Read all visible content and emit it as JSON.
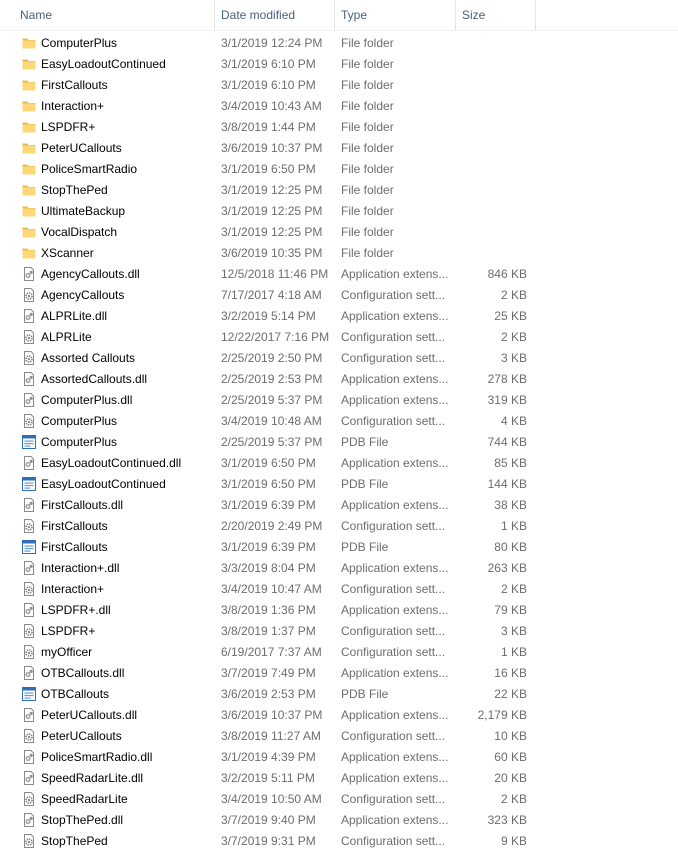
{
  "columns": {
    "name": "Name",
    "date": "Date modified",
    "type": "Type",
    "size": "Size"
  },
  "files": [
    {
      "name": "ComputerPlus",
      "date": "3/1/2019 12:24 PM",
      "type": "File folder",
      "size": "",
      "icon": "folder-icon"
    },
    {
      "name": "EasyLoadoutContinued",
      "date": "3/1/2019 6:10 PM",
      "type": "File folder",
      "size": "",
      "icon": "folder-icon"
    },
    {
      "name": "FirstCallouts",
      "date": "3/1/2019 6:10 PM",
      "type": "File folder",
      "size": "",
      "icon": "folder-icon"
    },
    {
      "name": "Interaction+",
      "date": "3/4/2019 10:43 AM",
      "type": "File folder",
      "size": "",
      "icon": "folder-icon"
    },
    {
      "name": "LSPDFR+",
      "date": "3/8/2019 1:44 PM",
      "type": "File folder",
      "size": "",
      "icon": "folder-icon"
    },
    {
      "name": "PeterUCallouts",
      "date": "3/6/2019 10:37 PM",
      "type": "File folder",
      "size": "",
      "icon": "folder-icon"
    },
    {
      "name": "PoliceSmartRadio",
      "date": "3/1/2019 6:50 PM",
      "type": "File folder",
      "size": "",
      "icon": "folder-icon"
    },
    {
      "name": "StopThePed",
      "date": "3/1/2019 12:25 PM",
      "type": "File folder",
      "size": "",
      "icon": "folder-icon"
    },
    {
      "name": "UltimateBackup",
      "date": "3/1/2019 12:25 PM",
      "type": "File folder",
      "size": "",
      "icon": "folder-icon"
    },
    {
      "name": "VocalDispatch",
      "date": "3/1/2019 12:25 PM",
      "type": "File folder",
      "size": "",
      "icon": "folder-icon"
    },
    {
      "name": "XScanner",
      "date": "3/6/2019 10:35 PM",
      "type": "File folder",
      "size": "",
      "icon": "folder-icon"
    },
    {
      "name": "AgencyCallouts.dll",
      "date": "12/5/2018 11:46 PM",
      "type": "Application extens...",
      "size": "846 KB",
      "icon": "dll-icon"
    },
    {
      "name": "AgencyCallouts",
      "date": "7/17/2017 4:18 AM",
      "type": "Configuration sett...",
      "size": "2 KB",
      "icon": "config-icon"
    },
    {
      "name": "ALPRLite.dll",
      "date": "3/2/2019 5:14 PM",
      "type": "Application extens...",
      "size": "25 KB",
      "icon": "dll-icon"
    },
    {
      "name": "ALPRLite",
      "date": "12/22/2017 7:16 PM",
      "type": "Configuration sett...",
      "size": "2 KB",
      "icon": "config-icon"
    },
    {
      "name": "Assorted Callouts",
      "date": "2/25/2019 2:50 PM",
      "type": "Configuration sett...",
      "size": "3 KB",
      "icon": "config-icon"
    },
    {
      "name": "AssortedCallouts.dll",
      "date": "2/25/2019 2:53 PM",
      "type": "Application extens...",
      "size": "278 KB",
      "icon": "dll-icon"
    },
    {
      "name": "ComputerPlus.dll",
      "date": "2/25/2019 5:37 PM",
      "type": "Application extens...",
      "size": "319 KB",
      "icon": "dll-icon"
    },
    {
      "name": "ComputerPlus",
      "date": "3/4/2019 10:48 AM",
      "type": "Configuration sett...",
      "size": "4 KB",
      "icon": "config-icon"
    },
    {
      "name": "ComputerPlus",
      "date": "2/25/2019 5:37 PM",
      "type": "PDB File",
      "size": "744 KB",
      "icon": "pdb-icon"
    },
    {
      "name": "EasyLoadoutContinued.dll",
      "date": "3/1/2019 6:50 PM",
      "type": "Application extens...",
      "size": "85 KB",
      "icon": "dll-icon"
    },
    {
      "name": "EasyLoadoutContinued",
      "date": "3/1/2019 6:50 PM",
      "type": "PDB File",
      "size": "144 KB",
      "icon": "pdb-icon"
    },
    {
      "name": "FirstCallouts.dll",
      "date": "3/1/2019 6:39 PM",
      "type": "Application extens...",
      "size": "38 KB",
      "icon": "dll-icon"
    },
    {
      "name": "FirstCallouts",
      "date": "2/20/2019 2:49 PM",
      "type": "Configuration sett...",
      "size": "1 KB",
      "icon": "config-icon"
    },
    {
      "name": "FirstCallouts",
      "date": "3/1/2019 6:39 PM",
      "type": "PDB File",
      "size": "80 KB",
      "icon": "pdb-icon"
    },
    {
      "name": "Interaction+.dll",
      "date": "3/3/2019 8:04 PM",
      "type": "Application extens...",
      "size": "263 KB",
      "icon": "dll-icon"
    },
    {
      "name": "Interaction+",
      "date": "3/4/2019 10:47 AM",
      "type": "Configuration sett...",
      "size": "2 KB",
      "icon": "config-icon"
    },
    {
      "name": "LSPDFR+.dll",
      "date": "3/8/2019 1:36 PM",
      "type": "Application extens...",
      "size": "79 KB",
      "icon": "dll-icon"
    },
    {
      "name": "LSPDFR+",
      "date": "3/8/2019 1:37 PM",
      "type": "Configuration sett...",
      "size": "3 KB",
      "icon": "config-icon"
    },
    {
      "name": "myOfficer",
      "date": "6/19/2017 7:37 AM",
      "type": "Configuration sett...",
      "size": "1 KB",
      "icon": "config-icon"
    },
    {
      "name": "OTBCallouts.dll",
      "date": "3/7/2019 7:49 PM",
      "type": "Application extens...",
      "size": "16 KB",
      "icon": "dll-icon"
    },
    {
      "name": "OTBCallouts",
      "date": "3/6/2019 2:53 PM",
      "type": "PDB File",
      "size": "22 KB",
      "icon": "pdb-icon"
    },
    {
      "name": "PeterUCallouts.dll",
      "date": "3/6/2019 10:37 PM",
      "type": "Application extens...",
      "size": "2,179 KB",
      "icon": "dll-icon"
    },
    {
      "name": "PeterUCallouts",
      "date": "3/8/2019 11:27 AM",
      "type": "Configuration sett...",
      "size": "10 KB",
      "icon": "config-icon"
    },
    {
      "name": "PoliceSmartRadio.dll",
      "date": "3/1/2019 4:39 PM",
      "type": "Application extens...",
      "size": "60 KB",
      "icon": "dll-icon"
    },
    {
      "name": "SpeedRadarLite.dll",
      "date": "3/2/2019 5:11 PM",
      "type": "Application extens...",
      "size": "20 KB",
      "icon": "dll-icon"
    },
    {
      "name": "SpeedRadarLite",
      "date": "3/4/2019 10:50 AM",
      "type": "Configuration sett...",
      "size": "2 KB",
      "icon": "config-icon"
    },
    {
      "name": "StopThePed.dll",
      "date": "3/7/2019 9:40 PM",
      "type": "Application extens...",
      "size": "323 KB",
      "icon": "dll-icon"
    },
    {
      "name": "StopThePed",
      "date": "3/7/2019 9:31 PM",
      "type": "Configuration sett...",
      "size": "9 KB",
      "icon": "config-icon"
    }
  ]
}
